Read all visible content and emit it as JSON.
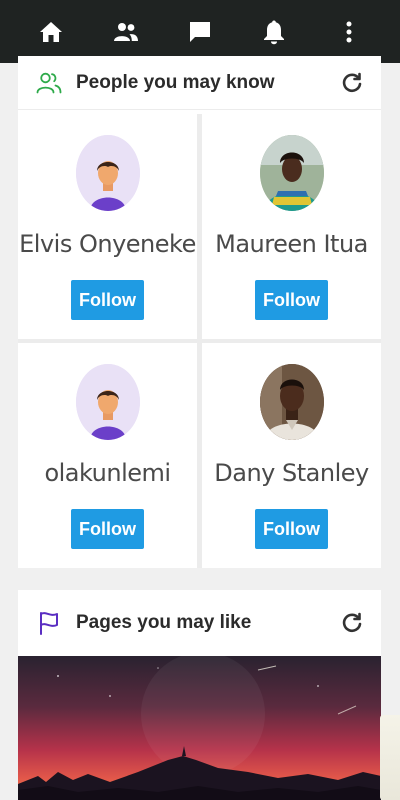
{
  "nav": {
    "items": [
      {
        "name": "home-icon"
      },
      {
        "name": "friends-icon"
      },
      {
        "name": "messages-icon"
      },
      {
        "name": "notifications-icon"
      },
      {
        "name": "more-icon"
      }
    ]
  },
  "people": {
    "title": "People you may know",
    "icon": "people-outline-icon",
    "accent": "#2eaa4a",
    "follow_label": "Follow",
    "list": [
      {
        "name": "Elvis Onyeneke",
        "avatar": "default-avatar"
      },
      {
        "name": "Maureen Itua",
        "avatar": "photo-avatar"
      },
      {
        "name": "olakunlemi",
        "avatar": "default-avatar"
      },
      {
        "name": "Dany Stanley",
        "avatar": "photo-avatar"
      }
    ]
  },
  "pages": {
    "title": "Pages you may like",
    "icon": "flag-icon",
    "accent": "#5a2ec2"
  },
  "colors": {
    "topbar": "#1f2322",
    "follow_button": "#1f9be3"
  }
}
